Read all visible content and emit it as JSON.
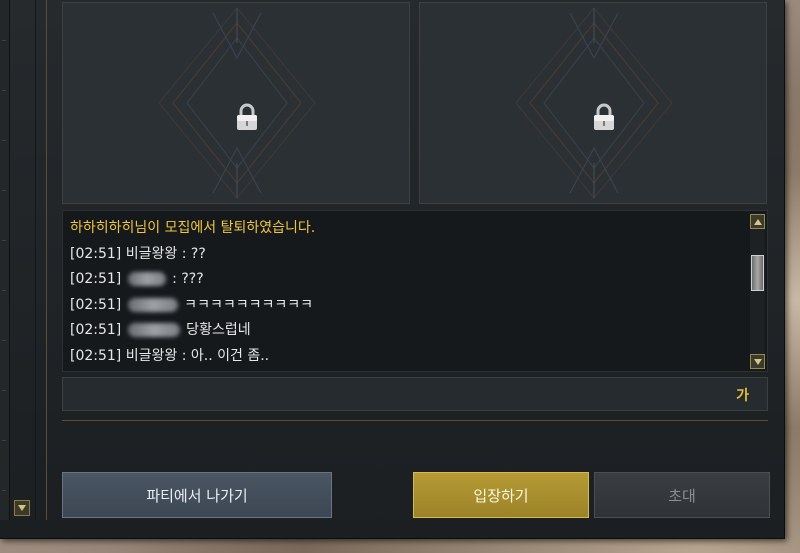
{
  "chat": {
    "lines": [
      {
        "type": "system",
        "text": "하하히하히님이 모집에서 탈퇴하였습니다."
      },
      {
        "type": "chat",
        "time": "[02:51]",
        "name": "비글왕왕",
        "message": " : ??"
      },
      {
        "type": "chat",
        "time": "[02:51]",
        "name": "",
        "message": " : ???"
      },
      {
        "type": "chat",
        "time": "[02:51]",
        "name": "",
        "message": " ㅋㅋㅋㅋㅋㅋㅋㅋㅋㅋ"
      },
      {
        "type": "chat",
        "time": "[02:51]",
        "name": "",
        "message": " 당황스럽네"
      },
      {
        "type": "chat",
        "time": "[02:51]",
        "name": "비글왕왕",
        "message": " : 아.. 이건 좀.."
      }
    ],
    "font_toggle": "가"
  },
  "buttons": {
    "leave": "파티에서 나가기",
    "enter": "입장하기",
    "invite": "초대"
  },
  "slots": [
    {
      "state": "locked",
      "icon": "lock-icon"
    },
    {
      "state": "locked",
      "icon": "lock-icon"
    }
  ],
  "colors": {
    "system_text": "#f0c640",
    "accent_gold": "#b59a34",
    "leave_button": "#4a5663"
  }
}
